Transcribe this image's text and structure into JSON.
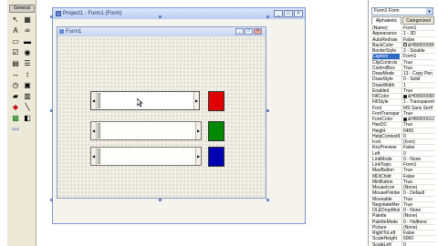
{
  "toolbox": {
    "title": "General",
    "tools": [
      {
        "name": "pointer",
        "glyph": "↖",
        "color": ""
      },
      {
        "name": "picturebox",
        "glyph": "▦",
        "color": ""
      },
      {
        "name": "label",
        "glyph": "A",
        "color": ""
      },
      {
        "name": "textbox",
        "glyph": "ab",
        "color": ""
      },
      {
        "name": "frame",
        "glyph": "▭",
        "color": ""
      },
      {
        "name": "commandbutton",
        "glyph": "▬",
        "color": ""
      },
      {
        "name": "checkbox",
        "glyph": "☑",
        "color": ""
      },
      {
        "name": "optionbutton",
        "glyph": "◉",
        "color": ""
      },
      {
        "name": "combobox",
        "glyph": "▤",
        "color": ""
      },
      {
        "name": "listbox",
        "glyph": "☰",
        "color": ""
      },
      {
        "name": "hscrollbar",
        "glyph": "↔",
        "color": ""
      },
      {
        "name": "vscrollbar",
        "glyph": "↕",
        "color": ""
      },
      {
        "name": "timer",
        "glyph": "◷",
        "color": ""
      },
      {
        "name": "drivelistbox",
        "glyph": "▣",
        "color": ""
      },
      {
        "name": "dirlistbox",
        "glyph": "▰",
        "color": ""
      },
      {
        "name": "filelistbox",
        "glyph": "▥",
        "color": ""
      },
      {
        "name": "shape",
        "glyph": "◆",
        "color": "red"
      },
      {
        "name": "line",
        "glyph": "╲",
        "color": ""
      },
      {
        "name": "image",
        "glyph": "▩",
        "color": "green"
      },
      {
        "name": "data",
        "glyph": "◧",
        "color": ""
      },
      {
        "name": "ole",
        "glyph": "OLE",
        "color": "blue"
      }
    ]
  },
  "project_window": {
    "title": "Project1 - Form1 (Form)"
  },
  "form": {
    "title": "Form1",
    "swatch_colors": [
      "#e00000",
      "#008800",
      "#0000b0"
    ]
  },
  "properties": {
    "object_selector": "Form1  Form",
    "tabs": [
      "Alphabetic",
      "Categorized"
    ],
    "rows": [
      {
        "name": "(Name)",
        "value": "Form1"
      },
      {
        "name": "Appearance",
        "value": "1 - 3D"
      },
      {
        "name": "AutoRedraw",
        "value": "False"
      },
      {
        "name": "BackColor",
        "value": "&H8000000F&",
        "swatch": "#ece9d8"
      },
      {
        "name": "BorderStyle",
        "value": "2 - Sizable"
      },
      {
        "name": "Caption",
        "value": "Form1",
        "selected": true
      },
      {
        "name": "ClipControls",
        "value": "True"
      },
      {
        "name": "ControlBox",
        "value": "True"
      },
      {
        "name": "DrawMode",
        "value": "13 - Copy Pen"
      },
      {
        "name": "DrawStyle",
        "value": "0 - Solid"
      },
      {
        "name": "DrawWidth",
        "value": "1"
      },
      {
        "name": "Enabled",
        "value": "True"
      },
      {
        "name": "FillColor",
        "value": "&H00000000&",
        "swatch": "#000000"
      },
      {
        "name": "FillStyle",
        "value": "1 - Transparent"
      },
      {
        "name": "Font",
        "value": "MS Sans Serif"
      },
      {
        "name": "FontTransparent",
        "value": "True"
      },
      {
        "name": "ForeColor",
        "value": "&H80000012&",
        "swatch": "#000000"
      },
      {
        "name": "HasDC",
        "value": "True"
      },
      {
        "name": "Height",
        "value": "6465"
      },
      {
        "name": "HelpContextID",
        "value": "0"
      },
      {
        "name": "Icon",
        "value": "(Icon)"
      },
      {
        "name": "KeyPreview",
        "value": "False"
      },
      {
        "name": "Left",
        "value": "0"
      },
      {
        "name": "LinkMode",
        "value": "0 - None"
      },
      {
        "name": "LinkTopic",
        "value": "Form1"
      },
      {
        "name": "MaxButton",
        "value": "True"
      },
      {
        "name": "MDIChild",
        "value": "False"
      },
      {
        "name": "MinButton",
        "value": "True"
      },
      {
        "name": "MouseIcon",
        "value": "(None)"
      },
      {
        "name": "MousePointer",
        "value": "0 - Default"
      },
      {
        "name": "Moveable",
        "value": "True"
      },
      {
        "name": "NegotiateMenus",
        "value": "True"
      },
      {
        "name": "OLEDropMode",
        "value": "0 - None"
      },
      {
        "name": "Palette",
        "value": "(None)"
      },
      {
        "name": "PaletteMode",
        "value": "0 - Halftone"
      },
      {
        "name": "Picture",
        "value": "(None)"
      },
      {
        "name": "RightToLeft",
        "value": "False"
      },
      {
        "name": "ScaleHeight",
        "value": "6060"
      },
      {
        "name": "ScaleLeft",
        "value": "0"
      },
      {
        "name": "ScaleMode",
        "value": "1 - Twip"
      }
    ]
  }
}
